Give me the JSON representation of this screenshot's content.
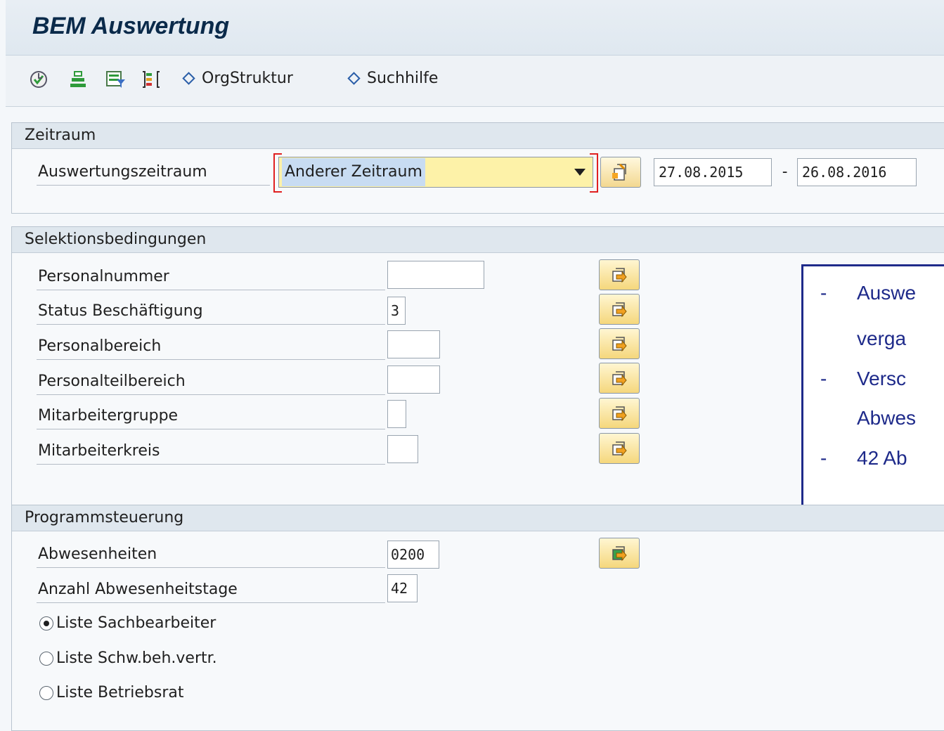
{
  "window": {
    "title": "BEM Auswertung"
  },
  "toolbar": {
    "icons": [
      "execute-icon",
      "variant-icon",
      "selection-options-icon",
      "dynamic-selection-icon"
    ],
    "links": [
      {
        "label": "OrgStruktur"
      },
      {
        "label": "Suchhilfe"
      }
    ]
  },
  "zeitraum": {
    "heading": "Zeitraum",
    "label": "Auswertungszeitraum",
    "dropdown_value": "Anderer Zeitraum",
    "date_from": "27.08.2015",
    "date_separator": "-",
    "date_to": "26.08.2016"
  },
  "selektion": {
    "heading": "Selektionsbedingungen",
    "rows": [
      {
        "label": "Personalnummer",
        "value": ""
      },
      {
        "label": "Status Beschäftigung",
        "value": "3"
      },
      {
        "label": "Personalbereich",
        "value": ""
      },
      {
        "label": "Personalteilbereich",
        "value": ""
      },
      {
        "label": "Mitarbeitergruppe",
        "value": ""
      },
      {
        "label": "Mitarbeiterkreis",
        "value": ""
      }
    ]
  },
  "programm": {
    "heading": "Programmsteuerung",
    "rows": [
      {
        "label": "Abwesenheiten",
        "value": "0200"
      },
      {
        "label": "Anzahl Abwesenheitstage",
        "value": "42"
      }
    ],
    "radios": [
      {
        "label": "Liste Sachbearbeiter",
        "selected": true
      },
      {
        "label": "Liste Schw.beh.vertr.",
        "selected": false
      },
      {
        "label": "Liste Betriebsrat",
        "selected": false
      }
    ]
  },
  "callout": {
    "lines": [
      {
        "dash": "-",
        "text": "Auswe"
      },
      {
        "dash": "",
        "text": "verga"
      },
      {
        "dash": "-",
        "text": "Versc"
      },
      {
        "dash": "",
        "text": "Abwes"
      },
      {
        "dash": "-",
        "text": "42 Ab"
      }
    ]
  },
  "colors": {
    "title": "#0a2a4a",
    "callout": "#1e2a8a",
    "required": "#e02020",
    "dropdown_bg": "#fdf2a8"
  }
}
